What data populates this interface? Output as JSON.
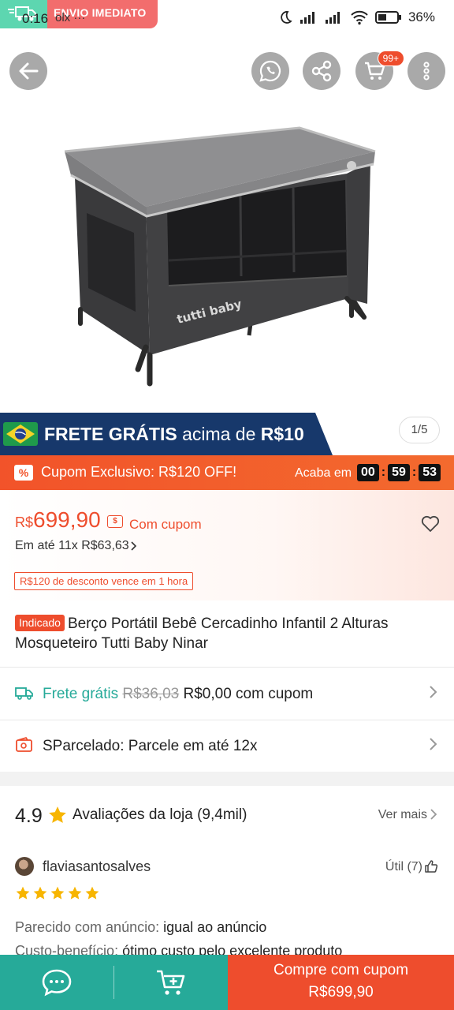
{
  "status_bar": {
    "time": "0:16",
    "extra": "olx ···",
    "battery": "36%",
    "badge_text": "ENVIO IMEDIATO"
  },
  "top_bar": {
    "cart_count": "99+",
    "icons": [
      "back-arrow-icon",
      "whatsapp-icon",
      "share-icon",
      "cart-icon",
      "more-vertical-icon"
    ]
  },
  "product_image": {
    "brand_logo": "tutti baby"
  },
  "frete_banner": {
    "bold": "FRETE GRÁTIS",
    "normal": "acima de",
    "amount": "R$10",
    "pager": "1/5"
  },
  "coupon_bar": {
    "text": "Cupom Exclusivo: R$120 OFF!",
    "ends_label": "Acaba em",
    "hours": "00",
    "minutes": "59",
    "seconds": "53"
  },
  "price": {
    "currency": "R$",
    "value": "699,90",
    "coupon_label": "Com cupom",
    "installments": "Em até 11x R$63,63",
    "discount_tag": "R$120 de desconto vence em 1 hora"
  },
  "product": {
    "badge": "Indicado",
    "title": "Berço Portátil Bebê Cercadinho Infantil 2 Alturas Mosqueteiro Tutti Baby Ninar"
  },
  "shipping": {
    "label": "Frete grátis",
    "old_price": "R$36,03",
    "new_price": "R$0,00 com cupom"
  },
  "sparcelado": {
    "text": "SParcelado: Parcele em até 12x"
  },
  "reviews": {
    "rating": "4.9",
    "label": "Avaliações da loja (9,4mil)",
    "see_more": "Ver mais",
    "reviewer": "flaviasantosalves",
    "helpful": "Útil (7)",
    "stars": 5,
    "line1_label": "Parecido com anúncio:",
    "line1_value": "igual ao anúncio",
    "line2_label": "Custo-benefício:",
    "line2_value": "ótimo custo pelo excelente produto"
  },
  "bottom_bar": {
    "buy_label": "Compre com cupom",
    "buy_price": "R$699,90"
  },
  "colors": {
    "primary": "#ee4d2d",
    "teal": "#26aa99",
    "navy": "#17386b"
  }
}
